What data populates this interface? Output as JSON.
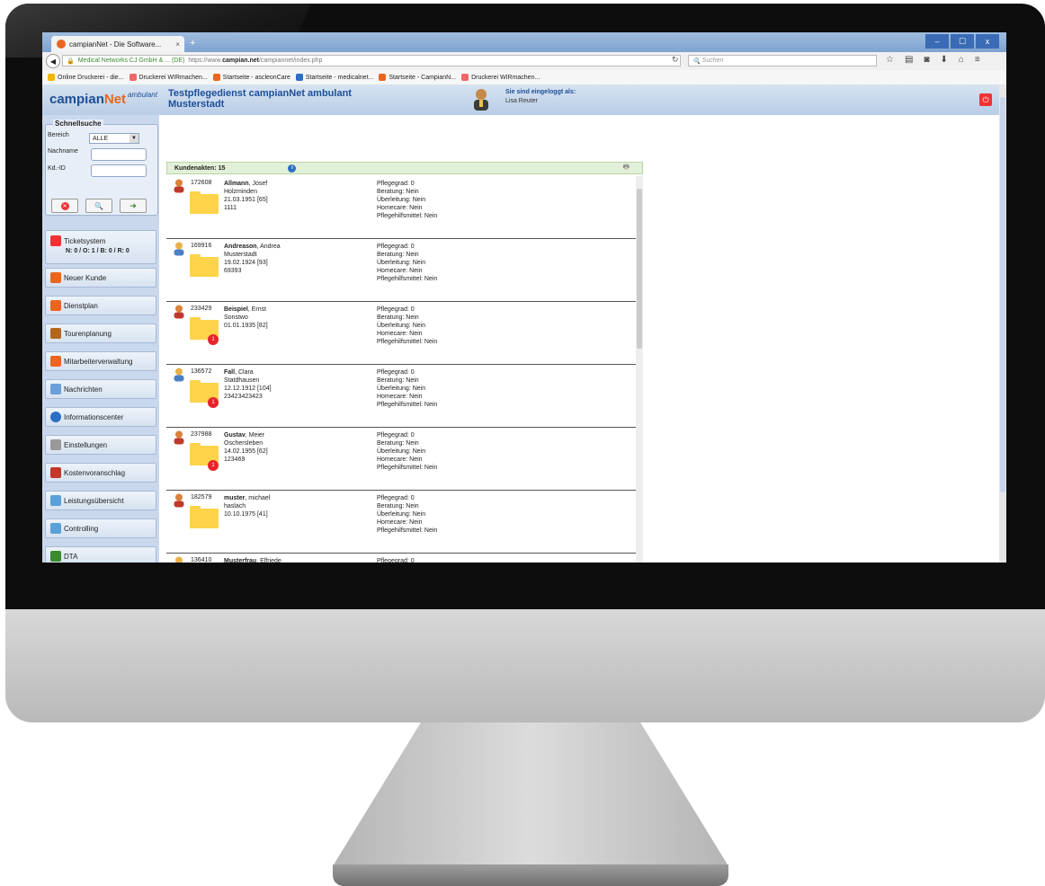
{
  "browser": {
    "tab_title": "campianNet - Die Software...",
    "tab_close": "×",
    "new_tab": "+",
    "win_min": "–",
    "win_max": "☐",
    "win_close": "x",
    "url_site": "Medical Networks CJ GmbH & ... (DE)",
    "url_prefix": "https://www.",
    "url_domain": "campian.net",
    "url_path": "/campiannet/index.php",
    "search_placeholder": "Suchen",
    "bookmarks": [
      {
        "label": "Online Druckerei - die...",
        "color": "#f4b400"
      },
      {
        "label": "Druckerei WIRmachen...",
        "color": "#e66"
      },
      {
        "label": "Startseite - ascleonCare",
        "color": "#e8661f"
      },
      {
        "label": "Startseite - medicalnet...",
        "color": "#2a6fc4"
      },
      {
        "label": "Startseite - CampianN...",
        "color": "#e8661f"
      },
      {
        "label": "Druckerei WIRmachen...",
        "color": "#e66"
      }
    ]
  },
  "header": {
    "logo_main": "campian",
    "logo_net": "Net",
    "logo_ambulant": "ambulant",
    "title_line1": "Testpflegedienst campianNet ambulant",
    "title_line2": "Musterstadt",
    "logged_in_label": "Sie sind eingeloggt als:",
    "user_name": "Lisa Reuter"
  },
  "quicksearch": {
    "title": "Schnellsuche",
    "area_label": "Bereich",
    "area_value": "ALLE",
    "lastname_label": "Nachname",
    "id_label": "Kd.-ID"
  },
  "sidebar": {
    "ticket_label": "Ticketsystem",
    "ticket_counts": "N: 0 / O: 1 / B: 0 / R: 0",
    "items": [
      {
        "label": "Neuer Kunde",
        "color": "#e8661f"
      },
      {
        "label": "Dienstplan",
        "color": "#e8661f"
      },
      {
        "label": "Tourenplanung",
        "color": "#b5651d"
      },
      {
        "label": "Mitarbeiterverwaltung",
        "color": "#e8661f"
      },
      {
        "label": "Nachrichten",
        "color": "#6a9fd8"
      },
      {
        "label": "Informationscenter",
        "color": "#2a6fc4"
      },
      {
        "label": "Einstellungen",
        "color": "#999999"
      },
      {
        "label": "Kostenvoranschlag",
        "color": "#c0392b"
      },
      {
        "label": "Leistungsübersicht",
        "color": "#5aa0d8"
      },
      {
        "label": "Controlling",
        "color": "#5aa0d8"
      },
      {
        "label": "DTA",
        "color": "#3a8a2e"
      }
    ]
  },
  "customers": {
    "header_label": "Kundenakten: 15",
    "rows": [
      {
        "id": "172608",
        "last": "Allmann",
        "first": ", Josef",
        "city": "Holzminden",
        "birth": "21.03.1951 [65]",
        "extra": "1111",
        "badge": "",
        "gender": "m"
      },
      {
        "id": "169916",
        "last": "Andreason",
        "first": ", Andrea",
        "city": "Musterstadt",
        "birth": "19.02.1924 [93]",
        "extra": "69393",
        "badge": "",
        "gender": "f"
      },
      {
        "id": "233429",
        "last": "Beispiel",
        "first": ", Ernst",
        "city": "Sonstwo",
        "birth": "01.01.1935 [82]",
        "extra": "",
        "badge": "1",
        "gender": "m"
      },
      {
        "id": "136572",
        "last": "Fall",
        "first": ", Clara",
        "city": "Statdhausen",
        "birth": "12.12.1912 [104]",
        "extra": "23423423423",
        "badge": "1",
        "gender": "f"
      },
      {
        "id": "237988",
        "last": "Gustav",
        "first": ", Meier",
        "city": "Oschersleben",
        "birth": "14.02.1955 [62]",
        "extra": "123469",
        "badge": "1",
        "gender": "m"
      },
      {
        "id": "182579",
        "last": "muster",
        "first": ", michael",
        "city": "haslach",
        "birth": "10.10.1975 [41]",
        "extra": "",
        "badge": "",
        "gender": "m"
      },
      {
        "id": "136410",
        "last": "Musterfrau",
        "first": ", Elfriede",
        "city": "",
        "birth": "",
        "extra": "",
        "badge": "",
        "gender": "f"
      }
    ],
    "status": {
      "pflegegrad": "Pflegegrad: 0",
      "beratung": "Beratung: Nein",
      "ueberleitung": "Überleitung: Nein",
      "homecare": "Homecare: Nein",
      "hilfsmittel": "Pflegehilfsmittel: Nein"
    }
  }
}
